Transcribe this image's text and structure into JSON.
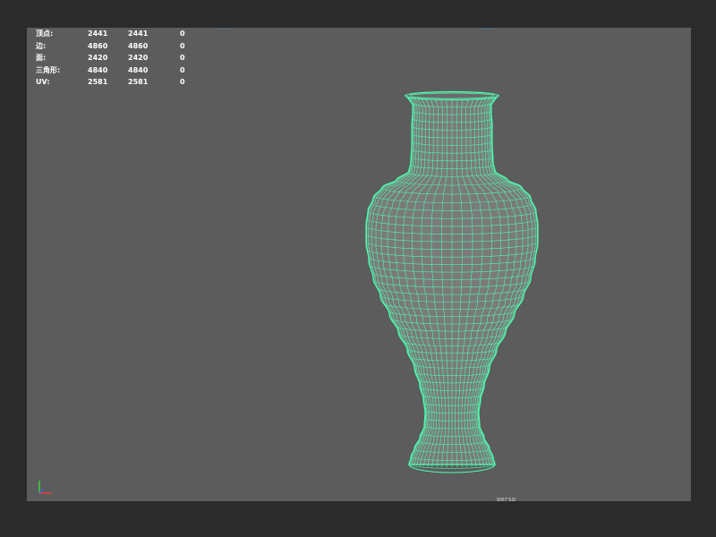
{
  "stats": {
    "rows": [
      {
        "label": "顶点:",
        "v1": "2441",
        "v2": "2441",
        "v3": "0"
      },
      {
        "label": "边:",
        "v1": "4860",
        "v2": "4860",
        "v3": "0"
      },
      {
        "label": "面:",
        "v1": "2420",
        "v2": "2420",
        "v3": "0"
      },
      {
        "label": "三角形:",
        "v1": "4840",
        "v2": "4840",
        "v3": "0"
      },
      {
        "label": "UV:",
        "v1": "2581",
        "v2": "2581",
        "v3": "0"
      }
    ]
  },
  "viewport": {
    "camera_label": "persp",
    "background_color": "#5c5c5c",
    "wireframe_color": "#4dffb0",
    "mesh_fill_color": "#7a7a7a"
  },
  "axis_icon": {
    "x_color": "#e04040",
    "y_color": "#40d040",
    "z_color": "#4060e0"
  }
}
